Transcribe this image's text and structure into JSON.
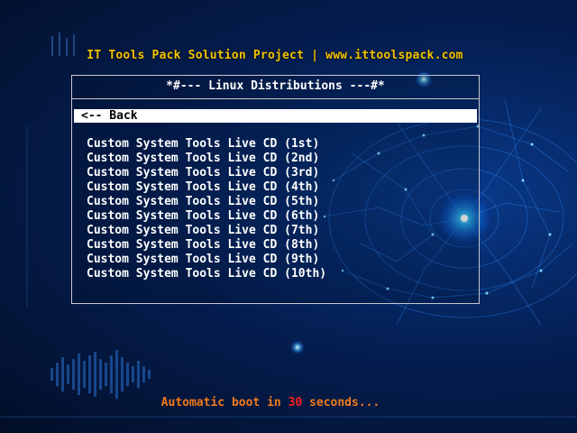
{
  "header": {
    "title": "IT Tools Pack Solution Project | www.ittoolspack.com"
  },
  "menu": {
    "title": "*#--- Linux Distributions ---#*",
    "back_label": "<-- Back",
    "items": [
      "Custom System Tools Live CD (1st)",
      "Custom System Tools Live CD (2nd)",
      "Custom System Tools Live CD (3rd)",
      "Custom System Tools Live CD (4th)",
      "Custom System Tools Live CD (5th)",
      "Custom System Tools Live CD (6th)",
      "Custom System Tools Live CD (7th)",
      "Custom System Tools Live CD (8th)",
      "Custom System Tools Live CD (9th)",
      "Custom System Tools Live CD (10th)"
    ]
  },
  "footer": {
    "prefix": "Automatic boot in ",
    "seconds": "30",
    "suffix": " seconds..."
  },
  "colors": {
    "header": "#f2c400",
    "footer_text": "#f07a1c",
    "footer_number": "#ff1e1e",
    "selection_bg": "#ffffff",
    "background": "#041d4f"
  }
}
